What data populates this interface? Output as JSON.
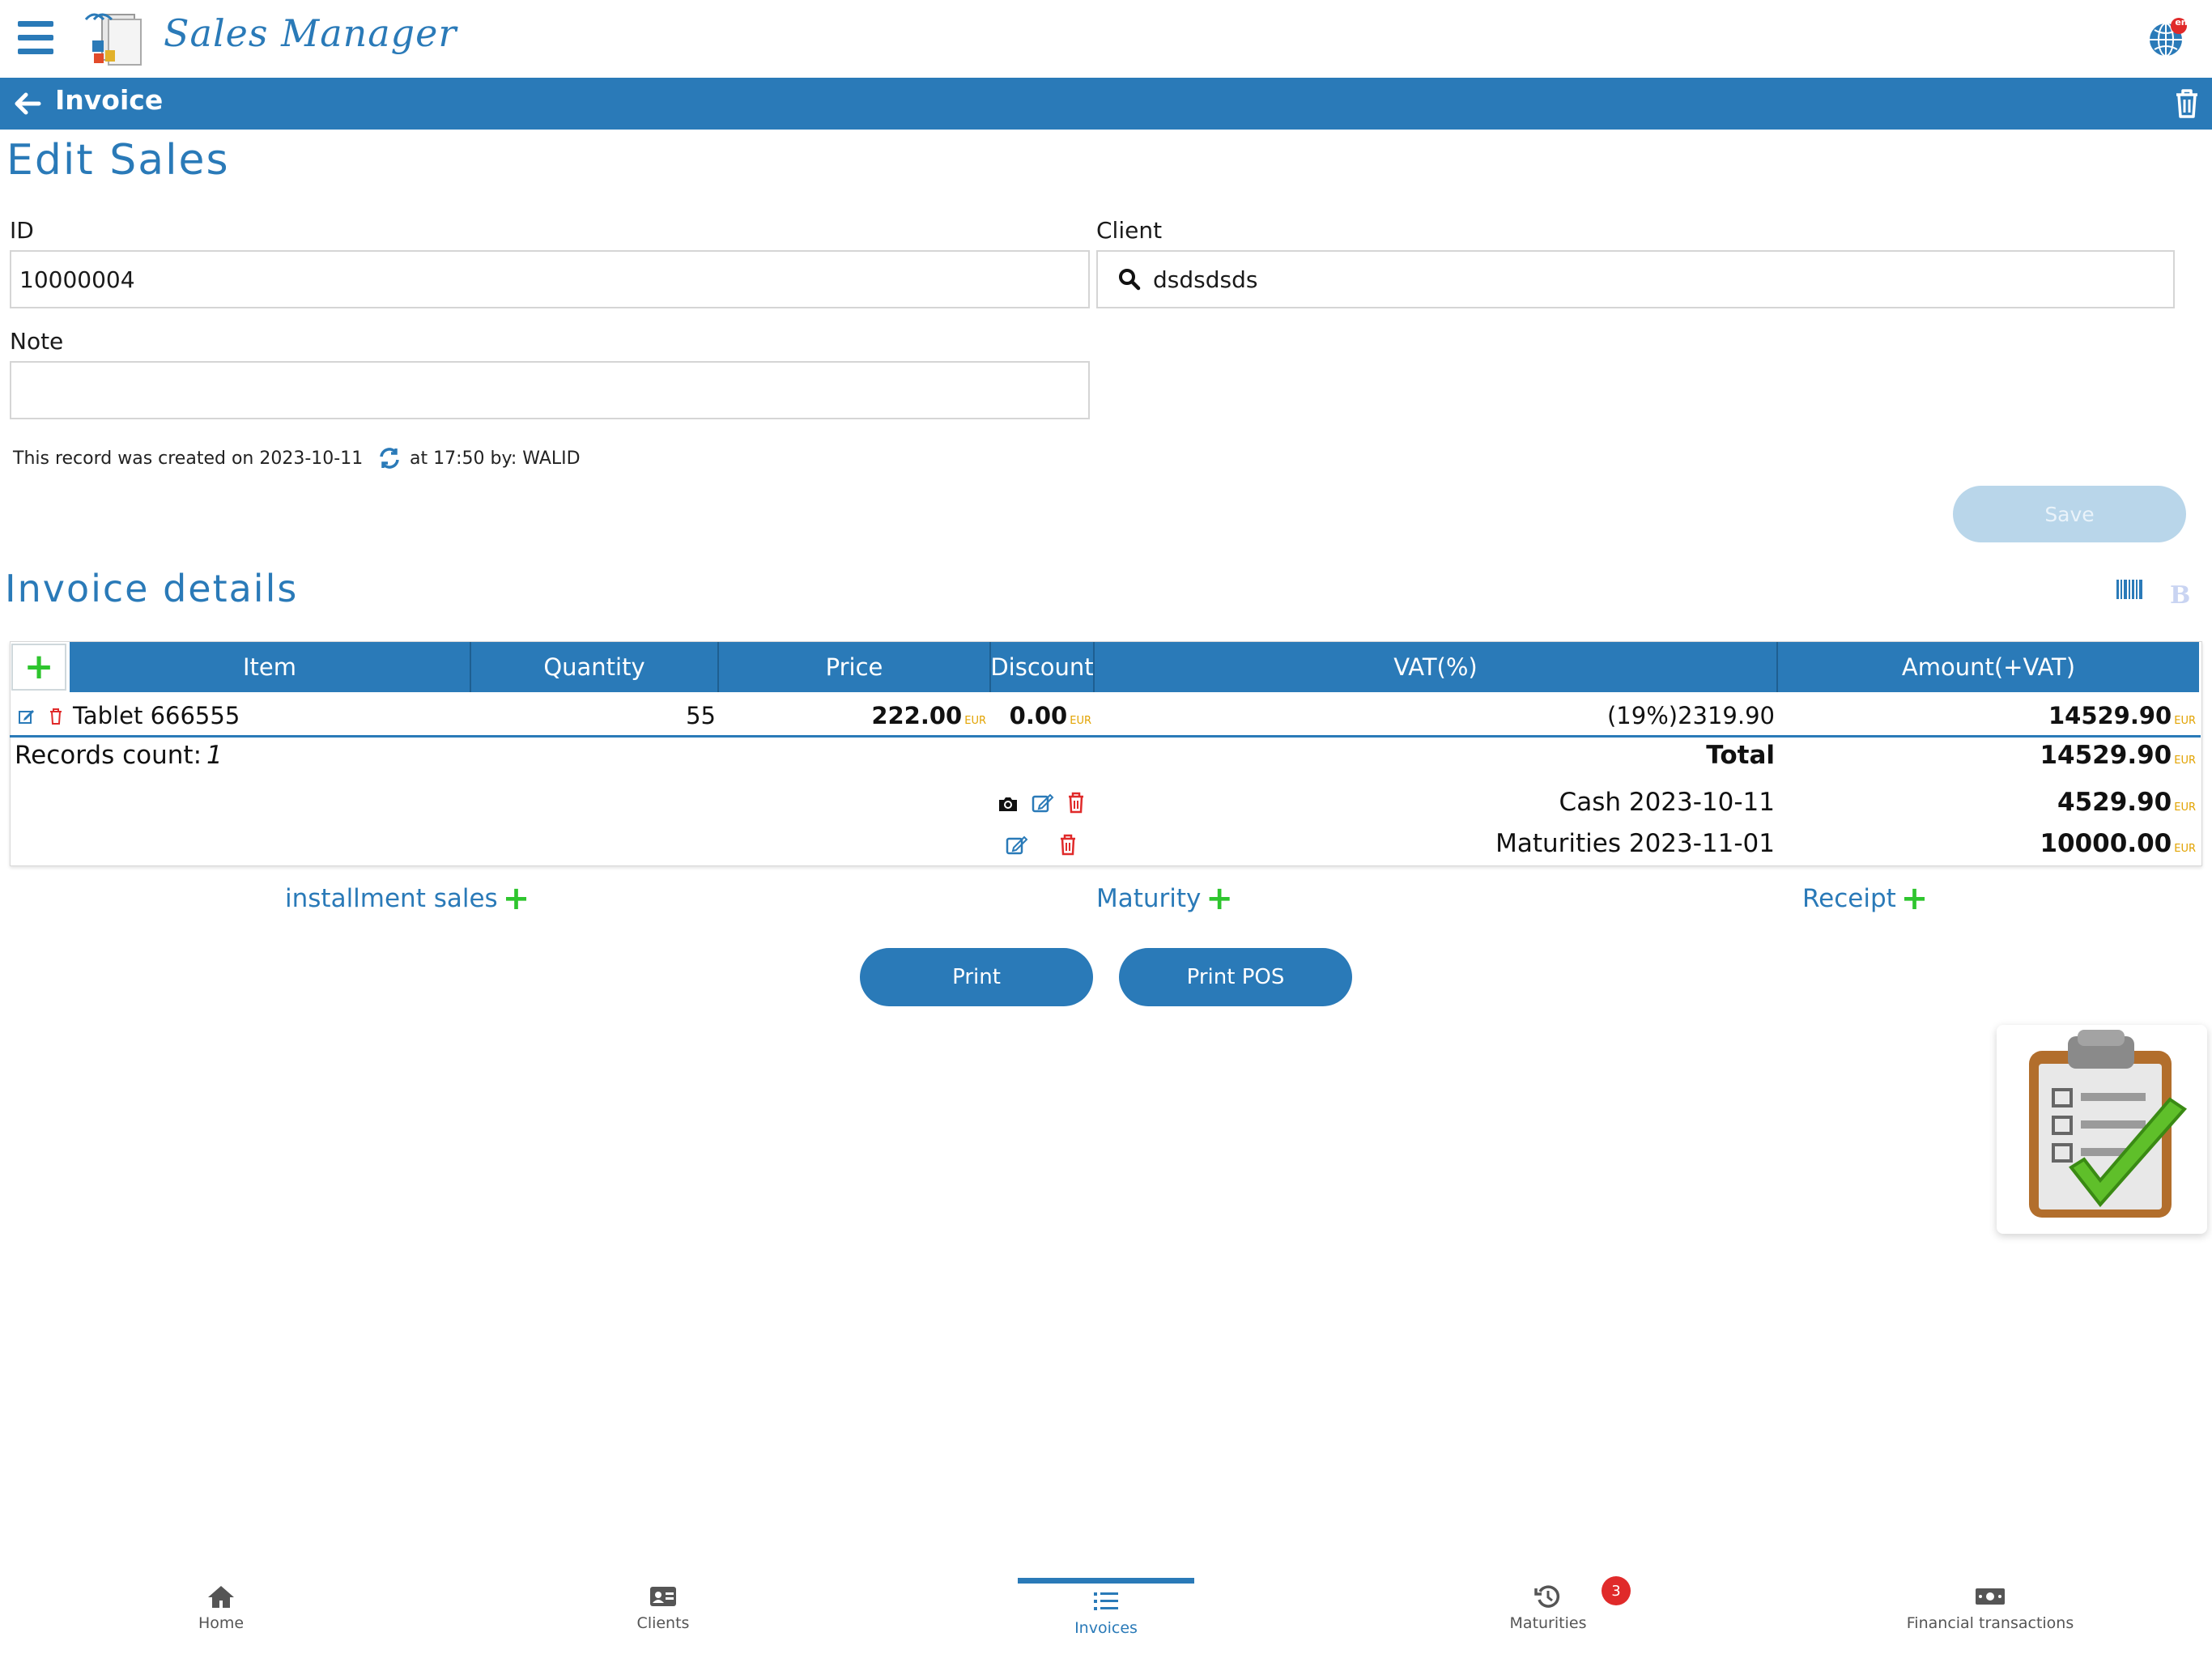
{
  "app": {
    "name": "Sales Manager",
    "language_badge": "en",
    "icons": {
      "menu": "hamburger-icon",
      "language": "globe-icon"
    }
  },
  "titlebar": {
    "title": "Invoice",
    "icons": {
      "back": "arrow-left-icon",
      "delete": "trash-icon"
    }
  },
  "form": {
    "heading": "Edit Sales",
    "id_label": "ID",
    "id_value": "10000004",
    "client_label": "Client",
    "client_value": "dsdsdsds",
    "note_label": "Note",
    "note_value": "",
    "record_info_prefix": "This record was created on 2023-10-11",
    "record_info_suffix": "at 17:50 by: WALID",
    "save_label": "Save"
  },
  "details": {
    "heading": "Invoice details",
    "columns": [
      "Item",
      "Quantity",
      "Price",
      "Discount",
      "VAT(%)",
      "Amount(+VAT)"
    ],
    "rows": [
      {
        "item": "Tablet 666555",
        "quantity": "55",
        "price": "222.00",
        "discount": "0.00",
        "vat": "(19%)2319.90",
        "amount": "14529.90"
      }
    ],
    "currency": "EUR",
    "records_count_label": "Records count:",
    "records_count_value": "1",
    "total_label": "Total",
    "total_value": "14529.90",
    "payments": [
      {
        "label": "Cash 2023-10-11",
        "value": "4529.90"
      },
      {
        "label": "Maturities 2023-11-01",
        "value": "10000.00"
      }
    ]
  },
  "actions": {
    "installment_label": "installment sales",
    "maturity_label": "Maturity",
    "receipt_label": "Receipt",
    "print_label": "Print",
    "print_pos_label": "Print POS"
  },
  "bottom_nav": {
    "items": [
      {
        "label": "Home",
        "icon": "home-icon"
      },
      {
        "label": "Clients",
        "icon": "id-card-icon"
      },
      {
        "label": "Invoices",
        "icon": "list-icon"
      },
      {
        "label": "Maturities",
        "icon": "history-icon"
      },
      {
        "label": "Financial transactions",
        "icon": "money-icon"
      }
    ],
    "maturities_badge": "3",
    "active": "Invoices"
  },
  "colors": {
    "primary": "#2a7ab8",
    "accent_green": "#2ec52e",
    "danger": "#e02a2a",
    "currency": "#e2a300"
  }
}
